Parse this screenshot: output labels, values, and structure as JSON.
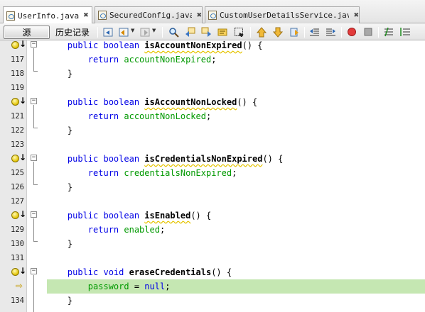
{
  "tabs": [
    {
      "label": "UserInfo.java",
      "active": true
    },
    {
      "label": "SecuredConfig.java",
      "active": false
    },
    {
      "label": "CustomUserDetailsService.java",
      "active": false
    }
  ],
  "toolbar": {
    "source_label": "源",
    "history_label": "历史记录"
  },
  "editor": {
    "lines": [
      {
        "num": "",
        "text": "    public boolean isAccountNonExpired() {"
      },
      {
        "num": "117",
        "text": "        return accountNonExpired;"
      },
      {
        "num": "118",
        "text": "    }"
      },
      {
        "num": "119",
        "text": ""
      },
      {
        "num": "",
        "text": "    public boolean isAccountNonLocked() {"
      },
      {
        "num": "121",
        "text": "        return accountNonLocked;"
      },
      {
        "num": "122",
        "text": "    }"
      },
      {
        "num": "123",
        "text": ""
      },
      {
        "num": "",
        "text": "    public boolean isCredentialsNonExpired() {"
      },
      {
        "num": "125",
        "text": "        return credentialsNonExpired;"
      },
      {
        "num": "126",
        "text": "    }"
      },
      {
        "num": "127",
        "text": ""
      },
      {
        "num": "",
        "text": "    public boolean isEnabled() {"
      },
      {
        "num": "129",
        "text": "        return enabled;"
      },
      {
        "num": "130",
        "text": "    }"
      },
      {
        "num": "131",
        "text": ""
      },
      {
        "num": "",
        "text": "    public void eraseCredentials() {"
      },
      {
        "num": "",
        "text": "        password = null;"
      },
      {
        "num": "134",
        "text": "    }"
      }
    ],
    "highlight_color": "#c5e7b2",
    "keyword_color": "#0000e6",
    "field_color": "#009900"
  }
}
